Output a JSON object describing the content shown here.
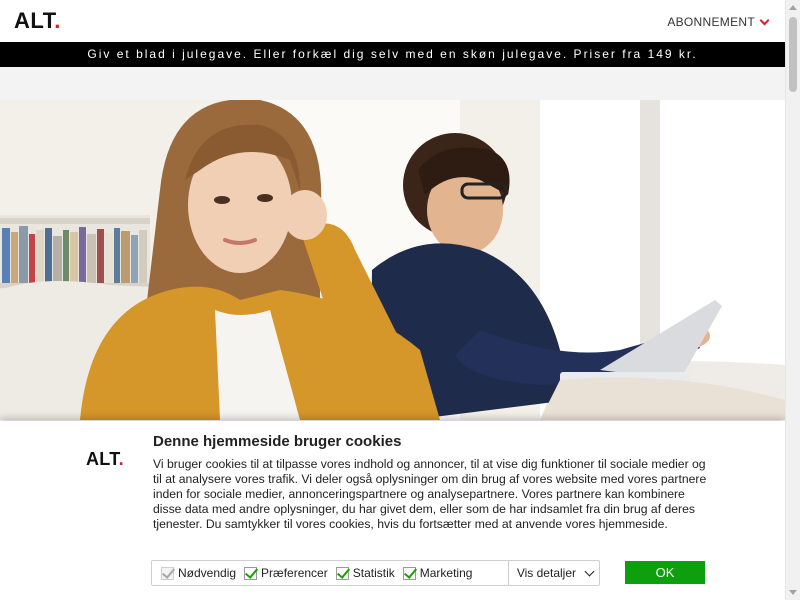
{
  "header": {
    "logo_text": "ALT",
    "logo_dot": ".",
    "subscribe_label": "ABONNEMENT"
  },
  "promo_banner": {
    "text": "Giv et blad i julegave. Eller forkæl dig selv med en skøn julegave. Priser fra 149 kr."
  },
  "cookie_banner": {
    "logo_text": "ALT",
    "logo_dot": ".",
    "title": "Denne hjemmeside bruger cookies",
    "body": "Vi bruger cookies til at tilpasse vores indhold og annoncer, til at vise dig funktioner til sociale medier og til at analysere vores trafik. Vi deler også oplysninger om din brug af vores website med vores partnere inden for sociale medier, annonceringspartnere og analysepartnere. Vores partnere kan kombinere disse data med andre oplysninger, du har givet dem, eller som de har indsamlet fra din brug af deres tjenester. Du samtykker til vores cookies, hvis du fortsætter med at anvende vores hjemmeside.",
    "options": [
      {
        "label": "Nødvendig",
        "checked": true,
        "disabled": true
      },
      {
        "label": "Præferencer",
        "checked": true,
        "disabled": false
      },
      {
        "label": "Statistik",
        "checked": true,
        "disabled": false
      },
      {
        "label": "Marketing",
        "checked": true,
        "disabled": false
      }
    ],
    "details_label": "Vis detaljer",
    "ok_label": "OK"
  },
  "colors": {
    "brand_red": "#d4202a",
    "ok_green": "#0e9f0e",
    "check_green": "#18a100"
  }
}
